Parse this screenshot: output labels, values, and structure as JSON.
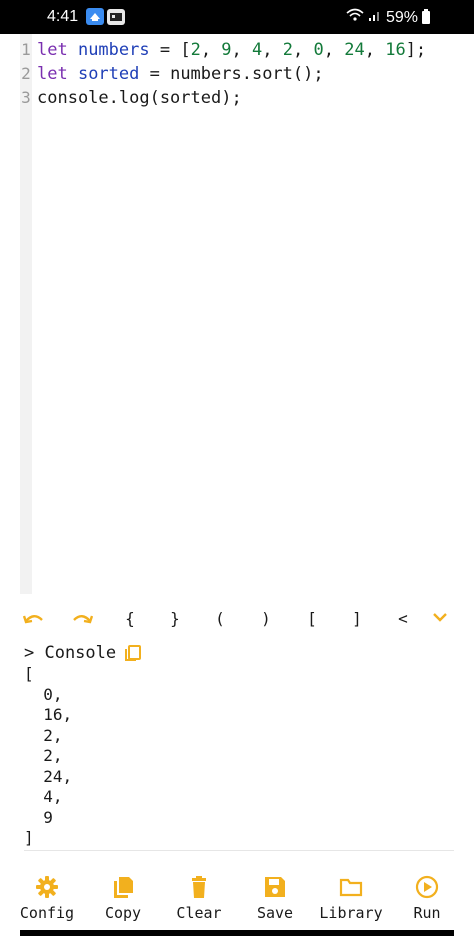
{
  "status_bar": {
    "time": "4:41",
    "battery": "59%"
  },
  "editor": {
    "lines": [
      {
        "no": "1",
        "tokens": [
          {
            "t": "let ",
            "c": "kw"
          },
          {
            "t": "numbers",
            "c": "var"
          },
          {
            "t": " = [",
            "c": "plain"
          },
          {
            "t": "2",
            "c": "num"
          },
          {
            "t": ", ",
            "c": "plain"
          },
          {
            "t": "9",
            "c": "num"
          },
          {
            "t": ", ",
            "c": "plain"
          },
          {
            "t": "4",
            "c": "num"
          },
          {
            "t": ", ",
            "c": "plain"
          },
          {
            "t": "2",
            "c": "num"
          },
          {
            "t": ", ",
            "c": "plain"
          },
          {
            "t": "0",
            "c": "num"
          },
          {
            "t": ", ",
            "c": "plain"
          },
          {
            "t": "24",
            "c": "num"
          },
          {
            "t": ", ",
            "c": "plain"
          },
          {
            "t": "16",
            "c": "num"
          },
          {
            "t": "];",
            "c": "plain"
          }
        ]
      },
      {
        "no": "2",
        "tokens": [
          {
            "t": "let ",
            "c": "kw"
          },
          {
            "t": "sorted",
            "c": "var"
          },
          {
            "t": " = numbers.sort();",
            "c": "plain"
          }
        ]
      },
      {
        "no": "3",
        "tokens": [
          {
            "t": "console.log(sorted);",
            "c": "plain"
          }
        ]
      }
    ]
  },
  "symbols": [
    "{",
    "}",
    "(",
    ")",
    "[",
    "]",
    "<"
  ],
  "console": {
    "title": "> Console",
    "output": "[\n  0,\n  16,\n  2,\n  2,\n  24,\n  4,\n  9\n]"
  },
  "bottom_bar": {
    "accent_color": "#f2b01e",
    "buttons": [
      {
        "label": "Config",
        "icon": "gear-icon"
      },
      {
        "label": "Copy",
        "icon": "copy-icon"
      },
      {
        "label": "Clear",
        "icon": "trash-icon"
      },
      {
        "label": "Save",
        "icon": "save-icon"
      },
      {
        "label": "Library",
        "icon": "folder-icon"
      },
      {
        "label": "Run",
        "icon": "play-icon"
      }
    ]
  }
}
